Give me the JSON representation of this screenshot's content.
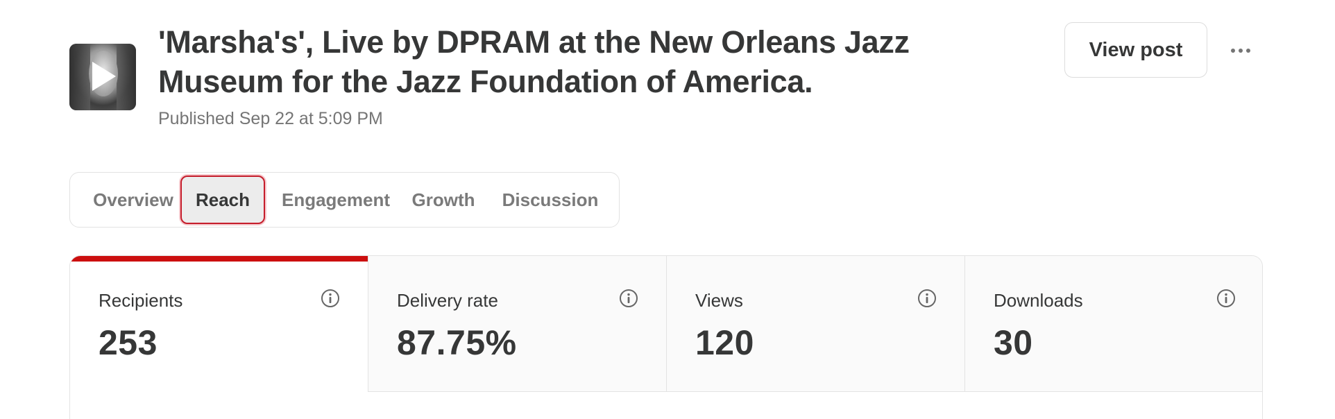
{
  "post": {
    "title": "'Marsha's', Live by DPRAM at the New Orleans Jazz Museum for the Jazz Foundation of America.",
    "published": "Published Sep 22 at 5:09 PM"
  },
  "actions": {
    "view_post_label": "View post",
    "more_icon": "more-horizontal-icon"
  },
  "tabs": [
    {
      "label": "Overview",
      "active": false
    },
    {
      "label": "Reach",
      "active": true
    },
    {
      "label": "Engagement",
      "active": false
    },
    {
      "label": "Growth",
      "active": false
    },
    {
      "label": "Discussion",
      "active": false
    }
  ],
  "stats": [
    {
      "label": "Recipients",
      "value": "253",
      "active": true,
      "icon": "info-icon"
    },
    {
      "label": "Delivery rate",
      "value": "87.75%",
      "active": false,
      "icon": "info-icon"
    },
    {
      "label": "Views",
      "value": "120",
      "active": false,
      "icon": "info-icon"
    },
    {
      "label": "Downloads",
      "value": "30",
      "active": false,
      "icon": "info-icon"
    }
  ],
  "colors": {
    "accent": "#cc0f0f",
    "text": "#363737",
    "muted": "#757575",
    "active_tab_bg": "#ececec",
    "card_bg": "#fafafa"
  }
}
